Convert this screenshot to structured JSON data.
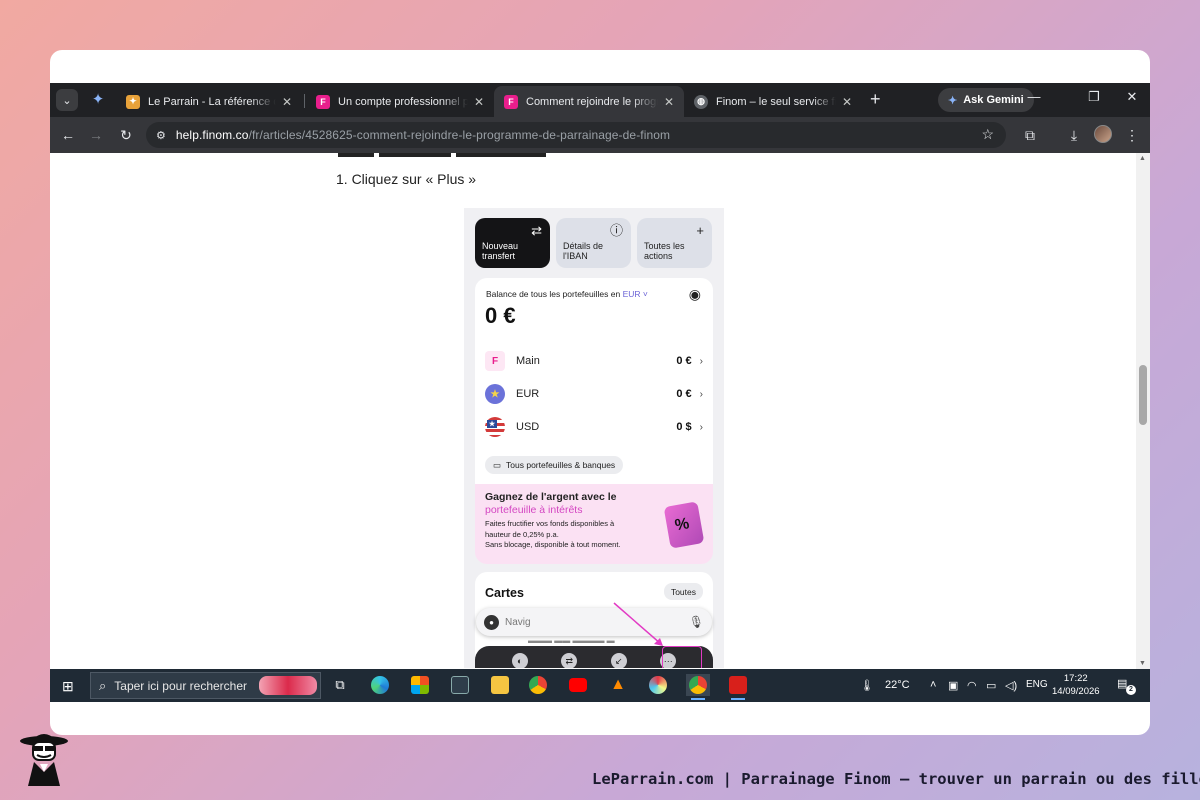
{
  "browser": {
    "tabs": [
      {
        "title": "Le Parrain - La référence du parrainage",
        "favicon_color": "#e8a23a",
        "active": false
      },
      {
        "title": "Un compte professionnel pour votre entreprise",
        "favicon_color": "#e91e8c",
        "active": false
      },
      {
        "title": "Comment rejoindre le programme de parrainage",
        "favicon_color": "#e91e8c",
        "active": true
      },
      {
        "title": "Finom – le seul service financier",
        "favicon_color": "#9aa0a6",
        "active": false
      }
    ],
    "gemini_label": "Ask Gemini",
    "url_host": "help.finom.co",
    "url_path": "/fr/articles/4528625-comment-rejoindre-le-programme-de-parrainage-de-finom"
  },
  "article": {
    "step_text": "1. Cliquez sur « Plus »"
  },
  "phone": {
    "quick_actions": [
      {
        "label": "Nouveau transfert",
        "icon": "swap-icon"
      },
      {
        "label": "Détails de l'IBAN",
        "icon": "info-icon"
      },
      {
        "label": "Toutes les actions",
        "icon": "plus-icon"
      }
    ],
    "balance_label": "Balance de tous les portefeuilles en",
    "balance_currency": "EUR",
    "balance_value": "0 €",
    "wallets": [
      {
        "name": "Main",
        "value": "0 €",
        "badge": "F",
        "color": "#fde7f4"
      },
      {
        "name": "EUR",
        "value": "0 €",
        "badge": "★",
        "color": "#6b72d9"
      },
      {
        "name": "USD",
        "value": "0 $",
        "badge": "★",
        "color": "#d33a3a"
      }
    ],
    "all_wallets_label": "Tous portefeuilles & banques",
    "promo": {
      "title": "Gagnez de l'argent avec le",
      "highlight": "portefeuille à intérêts",
      "line1": "Faites fructifier vos fonds disponibles à",
      "line2": "hauteur de 0,25% p.a.",
      "line3": "Sans blocage, disponible à tout moment."
    },
    "cards_title": "Cartes",
    "cards_all": "Toutes",
    "nav_placeholder": "Navig"
  },
  "taskbar": {
    "search_placeholder": "Taper ici pour rechercher",
    "weather": "22°C",
    "lang": "ENG",
    "time": "17:22",
    "date": "14/09/2026",
    "notifications": "2"
  },
  "footer": {
    "caption": "LeParrain.com | Parrainage Finom — trouver un parrain ou des filleuls"
  }
}
